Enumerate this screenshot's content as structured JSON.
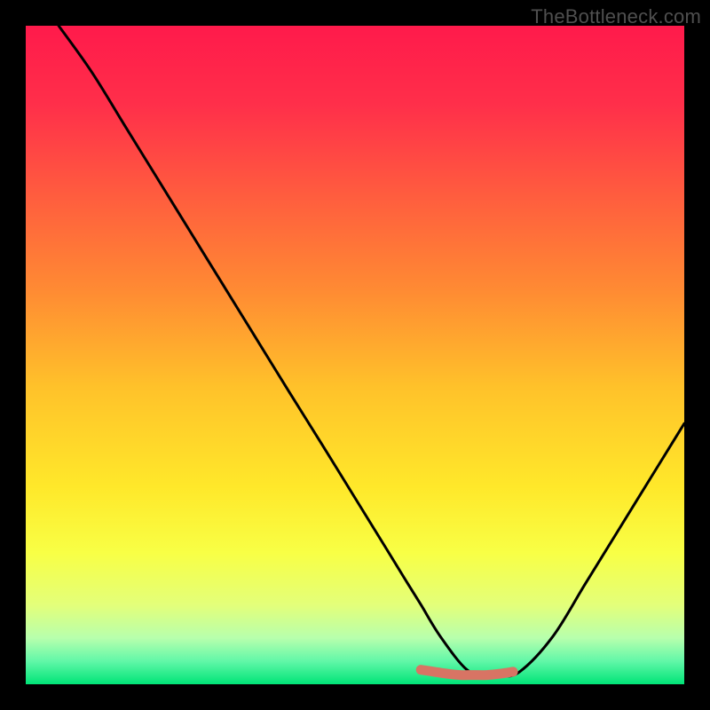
{
  "watermark": "TheBottleneck.com",
  "colors": {
    "frame": "#000000",
    "curve": "#000000",
    "marker_fill": "#d87464",
    "marker_stroke": "#c75b4c",
    "gradient_stops": [
      {
        "offset": 0.0,
        "color": "#ff1a4b"
      },
      {
        "offset": 0.12,
        "color": "#ff2f4a"
      },
      {
        "offset": 0.25,
        "color": "#ff5a3f"
      },
      {
        "offset": 0.4,
        "color": "#ff8a33"
      },
      {
        "offset": 0.55,
        "color": "#ffc22a"
      },
      {
        "offset": 0.7,
        "color": "#ffe82a"
      },
      {
        "offset": 0.8,
        "color": "#f8ff45"
      },
      {
        "offset": 0.88,
        "color": "#e3ff7a"
      },
      {
        "offset": 0.93,
        "color": "#b7ffad"
      },
      {
        "offset": 0.965,
        "color": "#61f7a8"
      },
      {
        "offset": 1.0,
        "color": "#00e477"
      }
    ]
  },
  "chart_data": {
    "type": "line",
    "title": "",
    "xlabel": "",
    "ylabel": "",
    "xlim": [
      0,
      100
    ],
    "ylim": [
      0,
      100
    ],
    "grid": false,
    "legend": false,
    "series": [
      {
        "name": "curve",
        "x": [
          5,
          10,
          15,
          20,
          25,
          30,
          35,
          40,
          45,
          50,
          55,
          58,
          60,
          63,
          67,
          70,
          72,
          75,
          80,
          85,
          90,
          95,
          100
        ],
        "y": [
          100,
          93.0,
          84.9,
          76.8,
          68.7,
          60.6,
          52.5,
          44.4,
          36.4,
          28.3,
          20.2,
          15.3,
          12.1,
          7.2,
          2.2,
          1.3,
          1.3,
          1.9,
          7.2,
          15.3,
          23.4,
          31.5,
          39.6
        ]
      }
    ],
    "markers": {
      "name": "valley",
      "x": [
        60,
        62,
        64,
        66,
        68,
        70,
        72,
        74
      ],
      "y": [
        2.2,
        1.9,
        1.6,
        1.4,
        1.4,
        1.4,
        1.6,
        1.9
      ]
    }
  }
}
